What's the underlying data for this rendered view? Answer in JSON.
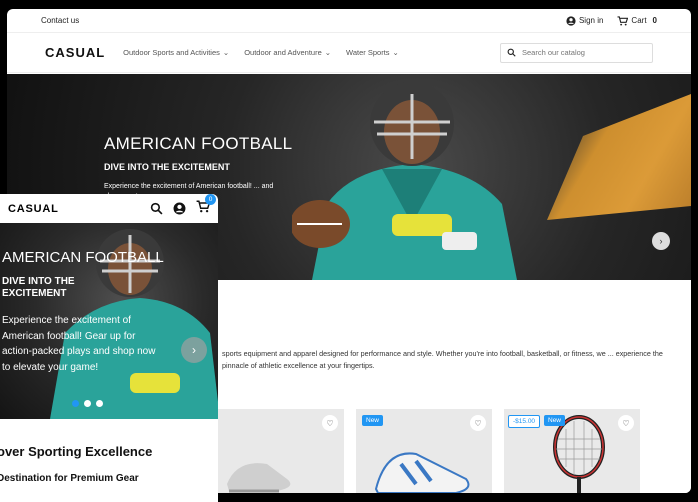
{
  "desktop": {
    "topbar": {
      "contact": "Contact us",
      "signin": "Sign in",
      "cart_label": "Cart",
      "cart_count": "0"
    },
    "logo": "CASUAL",
    "menu": [
      {
        "label": "Outdoor Sports and Activities"
      },
      {
        "label": "Outdoor and Adventure"
      },
      {
        "label": "Water Sports"
      }
    ],
    "search_placeholder": "Search our catalog",
    "hero": {
      "title": "AMERICAN FOOTBALL",
      "subtitle": "DIVE INTO THE EXCITEMENT",
      "desc": "Experience the excitement of American football! ... and shop now to"
    },
    "intro": "sports equipment and apparel designed for performance and style. Whether you're into football, basketball, or fitness, we ... experience the pinnacle of athletic excellence at your fingertips.",
    "products": [
      {
        "badge": "",
        "price_badge": ""
      },
      {
        "badge": "New",
        "price_badge": ""
      },
      {
        "badge": "New",
        "price_badge": "-$15.00"
      }
    ]
  },
  "mobile": {
    "logo": "CASUAL",
    "cart_count": "0",
    "hero": {
      "title": "AMERICAN FOOTBALL",
      "subtitle": "DIVE INTO THE EXCITEMENT",
      "desc": "Experience the excitement of American football! Gear up for action-packed plays and shop now to elevate your game!"
    },
    "heading": "over Sporting Excellence",
    "subheading": "Destination for Premium Gear"
  },
  "colors": {
    "accent": "#2196f3",
    "hero_orange": "#f0a83a"
  },
  "icons": [
    "user-icon",
    "cart-icon",
    "chevron-down-icon",
    "search-icon",
    "chevron-left-icon",
    "chevron-right-icon",
    "heart-icon"
  ]
}
